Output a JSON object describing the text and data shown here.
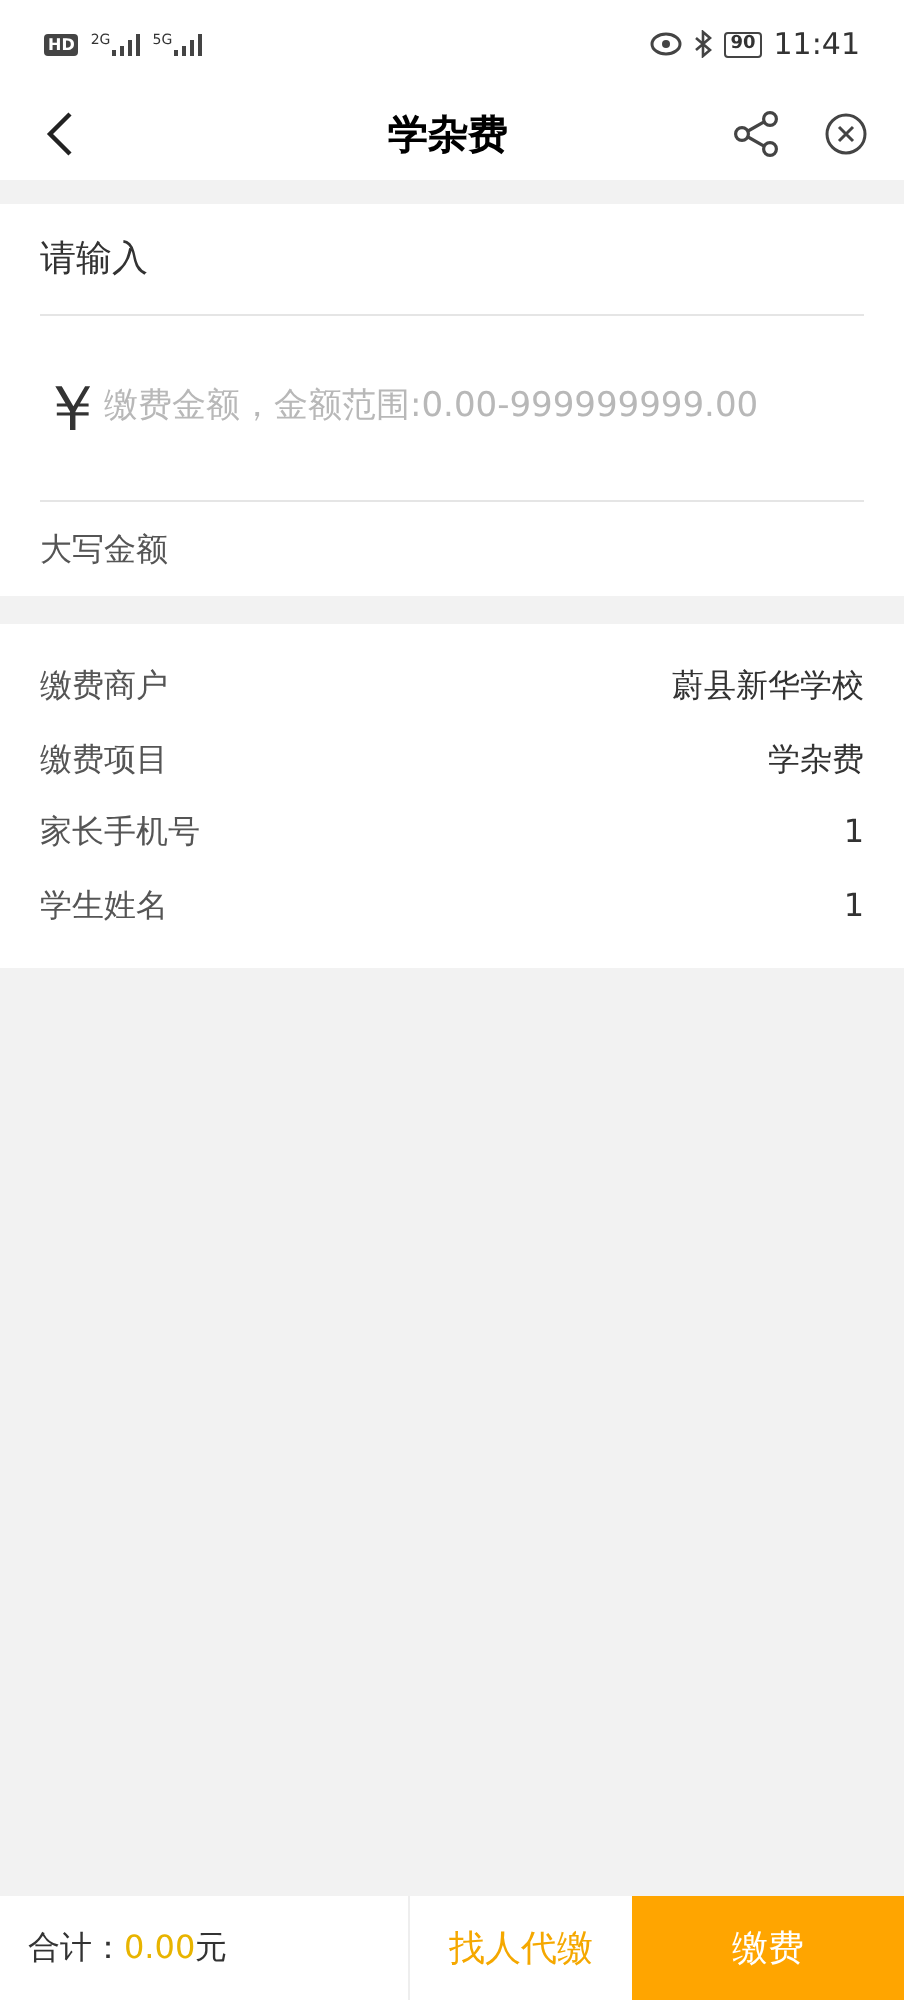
{
  "status_bar": {
    "left": [
      "HD",
      "2G",
      "5G"
    ],
    "battery": "90",
    "time": "11:41"
  },
  "header": {
    "title": "学杂费"
  },
  "input_section": {
    "title": "请输入",
    "currency": "￥",
    "amount": {
      "placeholder": "缴费金额，金额范围:0.00-999999999.00"
    },
    "uppercase_label": "大写金额"
  },
  "details": [
    {
      "label": "缴费商户",
      "value": "蔚县新华学校"
    },
    {
      "label": "缴费项目",
      "value": "学杂费"
    },
    {
      "label": "家长手机号",
      "value": "1"
    },
    {
      "label": "学生姓名",
      "value": "1"
    }
  ],
  "footer": {
    "total_label": "合计：",
    "total": "0.00",
    "unit": "元",
    "buttons": [
      {
        "label": "找人代缴",
        "kind": "secondary"
      },
      {
        "label": "缴费",
        "kind": "primary"
      }
    ]
  }
}
